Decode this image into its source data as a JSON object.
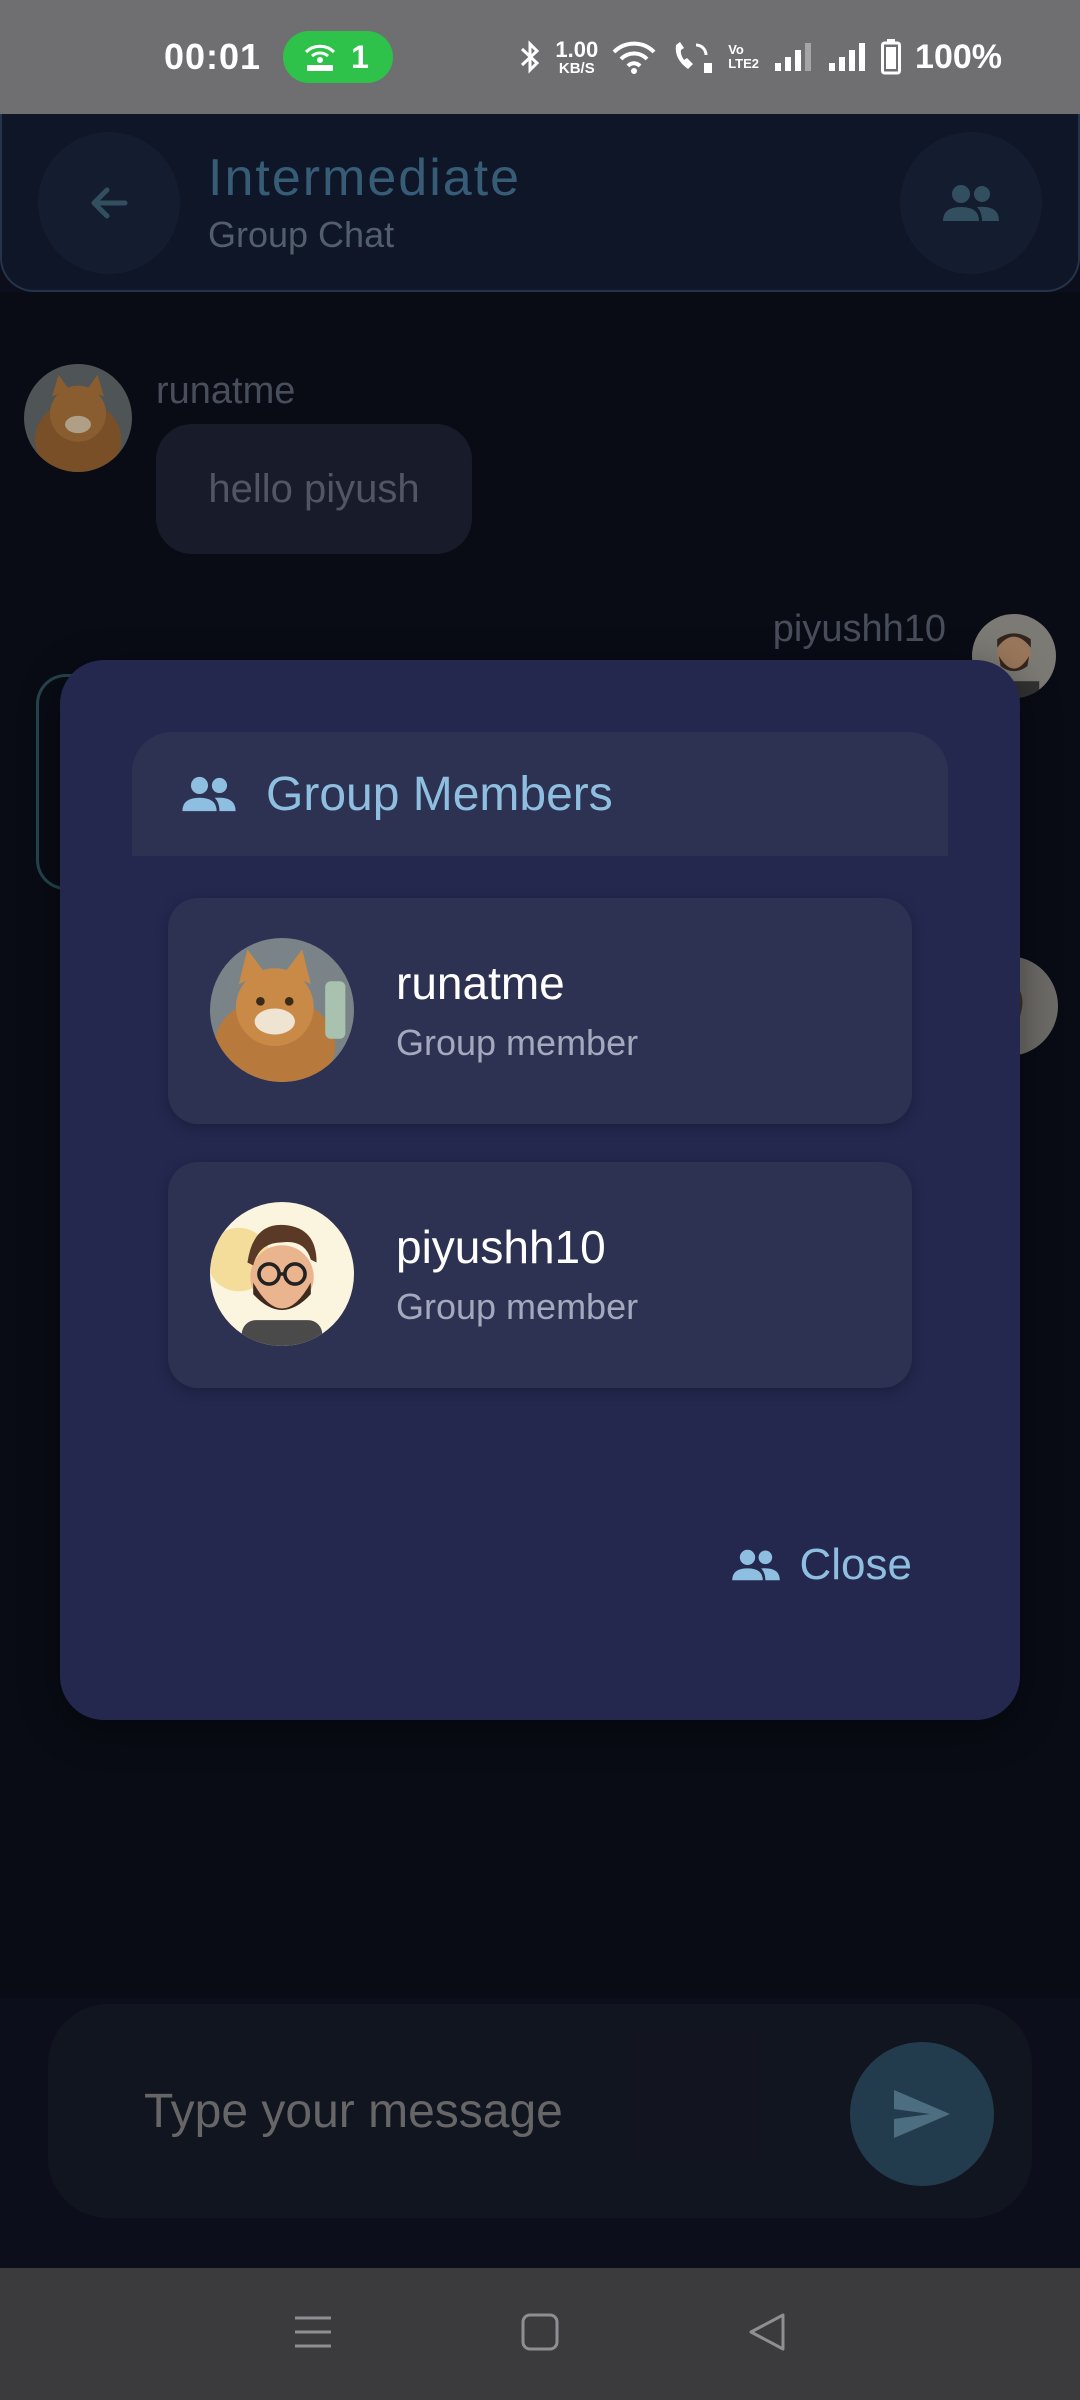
{
  "status_bar": {
    "time": "00:01",
    "hotspot_count": "1",
    "net_speed_value": "1.00",
    "net_speed_unit": "KB/S",
    "volte_top": "Vo",
    "volte_bottom": "LTE2",
    "battery_percent": "100%"
  },
  "header": {
    "title": "Intermediate",
    "subtitle": "Group Chat"
  },
  "messages": [
    {
      "sender": "runatme",
      "text": "hello piyush"
    },
    {
      "sender": "piyushh10"
    }
  ],
  "dialog": {
    "title": "Group Members",
    "members": [
      {
        "name": "runatme",
        "role": "Group member"
      },
      {
        "name": "piyushh10",
        "role": "Group member"
      }
    ],
    "close_label": "Close"
  },
  "input": {
    "placeholder": "Type your message"
  },
  "colors": {
    "accent": "#8fbfe0",
    "dialog_bg": "#24284f",
    "card_bg": "#2d3253",
    "hotspot_green": "#2fc24b"
  }
}
